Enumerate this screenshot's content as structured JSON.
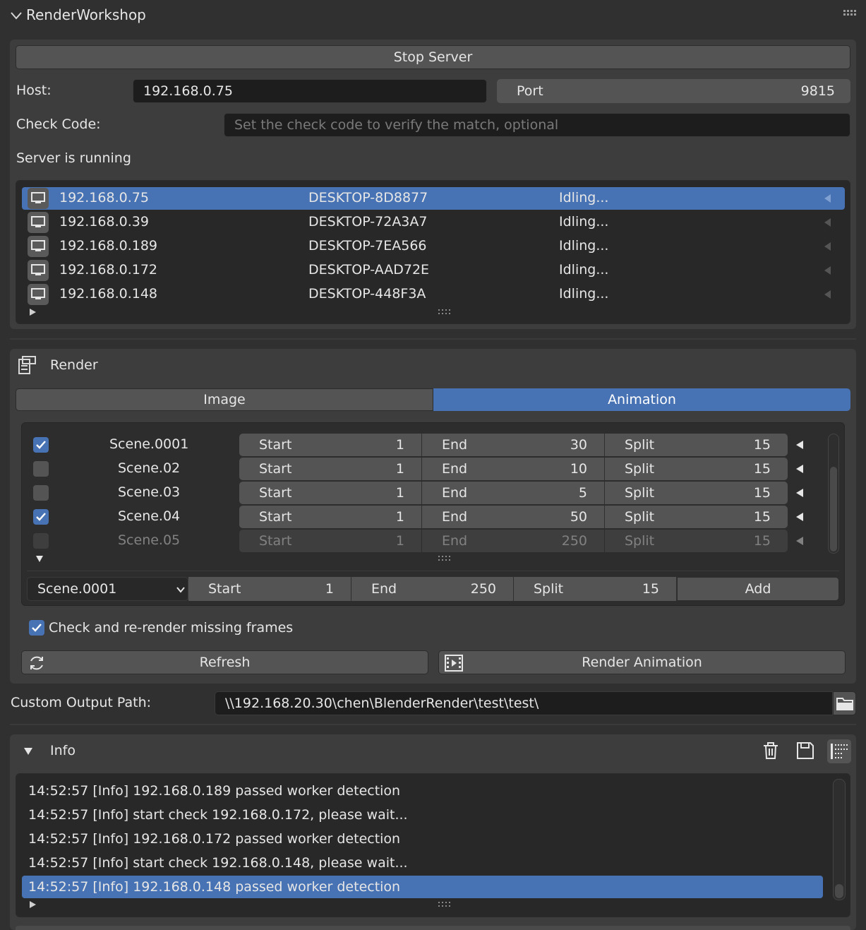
{
  "header": {
    "title": "RenderWorkshop"
  },
  "server": {
    "stop_label": "Stop Server",
    "host_label": "Host:",
    "host_value": "192.168.0.75",
    "port_label": "Port",
    "port_value": "9815",
    "check_label": "Check Code:",
    "check_placeholder": "Set the check code to verify the match, optional",
    "status": "Server is running"
  },
  "workers": [
    {
      "ip": "192.168.0.75",
      "name": "DESKTOP-8D8877",
      "status": "Idling..."
    },
    {
      "ip": "192.168.0.39",
      "name": "DESKTOP-72A3A7",
      "status": "Idling..."
    },
    {
      "ip": "192.168.0.189",
      "name": "DESKTOP-7EA566",
      "status": "Idling..."
    },
    {
      "ip": "192.168.0.172",
      "name": "DESKTOP-AAD72E",
      "status": "Idling..."
    },
    {
      "ip": "192.168.0.148",
      "name": "DESKTOP-448F3A",
      "status": "Idling..."
    }
  ],
  "render": {
    "title": "Render",
    "tabs": [
      "Image",
      "Animation"
    ],
    "active_tab": "Animation",
    "start_label": "Start",
    "end_label": "End",
    "split_label": "Split",
    "scenes": [
      {
        "checked": true,
        "name": "Scene.0001",
        "start": "1",
        "end": "30",
        "split": "15"
      },
      {
        "checked": false,
        "name": "Scene.02",
        "start": "1",
        "end": "10",
        "split": "15"
      },
      {
        "checked": false,
        "name": "Scene.03",
        "start": "1",
        "end": "5",
        "split": "15"
      },
      {
        "checked": true,
        "name": "Scene.04",
        "start": "1",
        "end": "50",
        "split": "15"
      },
      {
        "checked": false,
        "name": "Scene.05",
        "start": "1",
        "end": "250",
        "split": "15"
      }
    ],
    "add_row": {
      "scene": "Scene.0001",
      "start": "1",
      "end": "250",
      "split": "15",
      "add_label": "Add"
    },
    "missing_frames_label": "Check and re-render missing frames",
    "missing_frames_checked": true,
    "refresh_label": "Refresh",
    "render_anim_label": "Render Animation",
    "output_label": "Custom Output Path:",
    "output_path": "\\\\192.168.20.30\\chen\\BlenderRender\\test\\test\\"
  },
  "info": {
    "title": "Info",
    "logs": [
      "14:52:57 [Info] 192.168.0.189 passed worker detection",
      "14:52:57 [Info] start check 192.168.0.172, please wait...",
      "14:52:57 [Info] 192.168.0.172 passed worker detection",
      "14:52:57 [Info] start check 192.168.0.148, please wait...",
      "14:52:57 [Info] 192.168.0.148 passed worker detection"
    ]
  },
  "colors": {
    "accent": "#4772b3",
    "background": "#303030",
    "panel": "#3d3d3d",
    "field": "#1d1d1d"
  }
}
